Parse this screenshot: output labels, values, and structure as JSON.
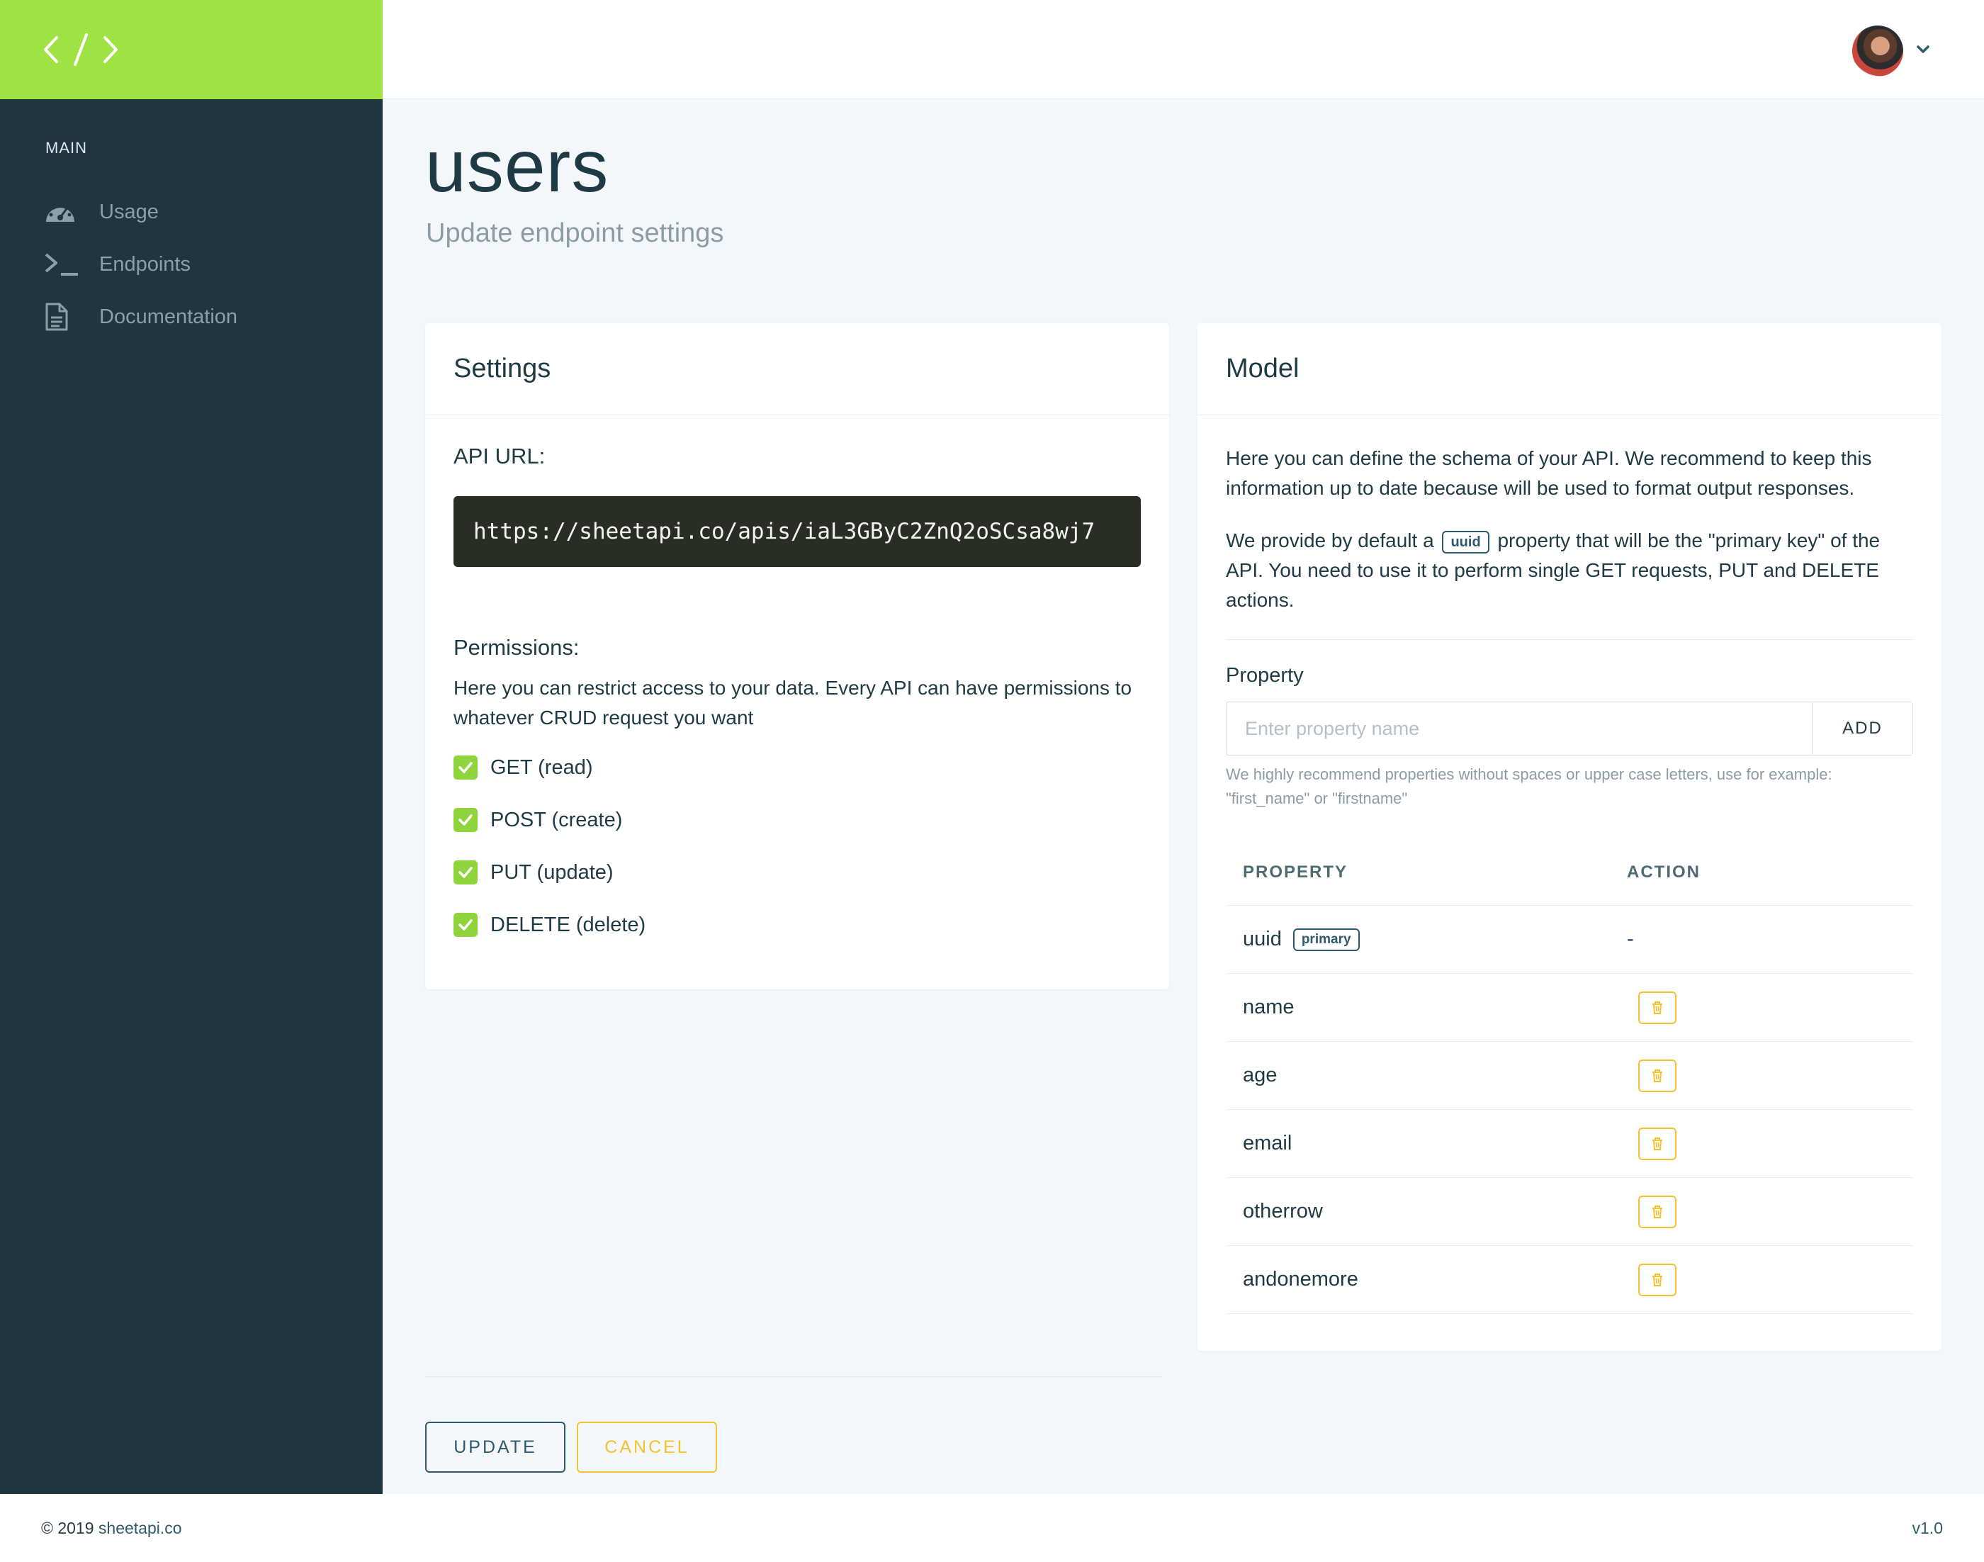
{
  "sidebar": {
    "logo_icon": "code-brackets-icon",
    "section_label": "MAIN",
    "items": [
      {
        "label": "Usage",
        "icon": "speedometer-icon"
      },
      {
        "label": "Endpoints",
        "icon": "terminal-icon"
      },
      {
        "label": "Documentation",
        "icon": "document-icon"
      }
    ]
  },
  "header": {
    "avatar": "user-avatar",
    "menu_icon": "chevron-down-icon"
  },
  "page": {
    "title": "users",
    "subtitle": "Update endpoint settings"
  },
  "settings": {
    "title": "Settings",
    "api_url_label": "API URL:",
    "api_url": "https://sheetapi.co/apis/iaL3GByC2ZnQ2oSCsa8wj7",
    "permissions_label": "Permissions:",
    "permissions_description": "Here you can restrict access to your data. Every API can have permissions to whatever CRUD request you want",
    "permissions": [
      {
        "label": "GET (read)",
        "checked": true
      },
      {
        "label": "POST (create)",
        "checked": true
      },
      {
        "label": "PUT (update)",
        "checked": true
      },
      {
        "label": "DELETE (delete)",
        "checked": true
      }
    ]
  },
  "model": {
    "title": "Model",
    "description_1": "Here you can define the schema of your API. We recommend to keep this information up to date because will be used to format output responses.",
    "description_2_prefix": "We provide by default a",
    "description_2_badge": "uuid",
    "description_2_suffix": "property that will be the \"primary key\" of the API. You need to use it to perform single GET requests, PUT and DELETE actions.",
    "property_label": "Property",
    "property_placeholder": "Enter property name",
    "property_value": "",
    "add_label": "ADD",
    "hint": "We highly recommend properties without spaces or upper case letters, use for example: \"first_name\" or \"firstname\"",
    "table": {
      "headers": [
        "PROPERTY",
        "ACTION"
      ],
      "rows": [
        {
          "name": "uuid",
          "badge": "primary",
          "action": "-"
        },
        {
          "name": "name",
          "action": "delete"
        },
        {
          "name": "age",
          "action": "delete"
        },
        {
          "name": "email",
          "action": "delete"
        },
        {
          "name": "otherrow",
          "action": "delete"
        },
        {
          "name": "andonemore",
          "action": "delete"
        }
      ]
    }
  },
  "actions": {
    "update_label": "UPDATE",
    "cancel_label": "CANCEL"
  },
  "footer": {
    "copyright": "© 2019",
    "site_link": "sheetapi.co",
    "version": "v1.0"
  },
  "colors": {
    "brand_green": "#9fe244",
    "sidebar_bg": "#1f3640",
    "checkbox_green": "#8fd43c",
    "accent_yellow": "#f2c230",
    "primary_dark": "#2f5a6b"
  }
}
